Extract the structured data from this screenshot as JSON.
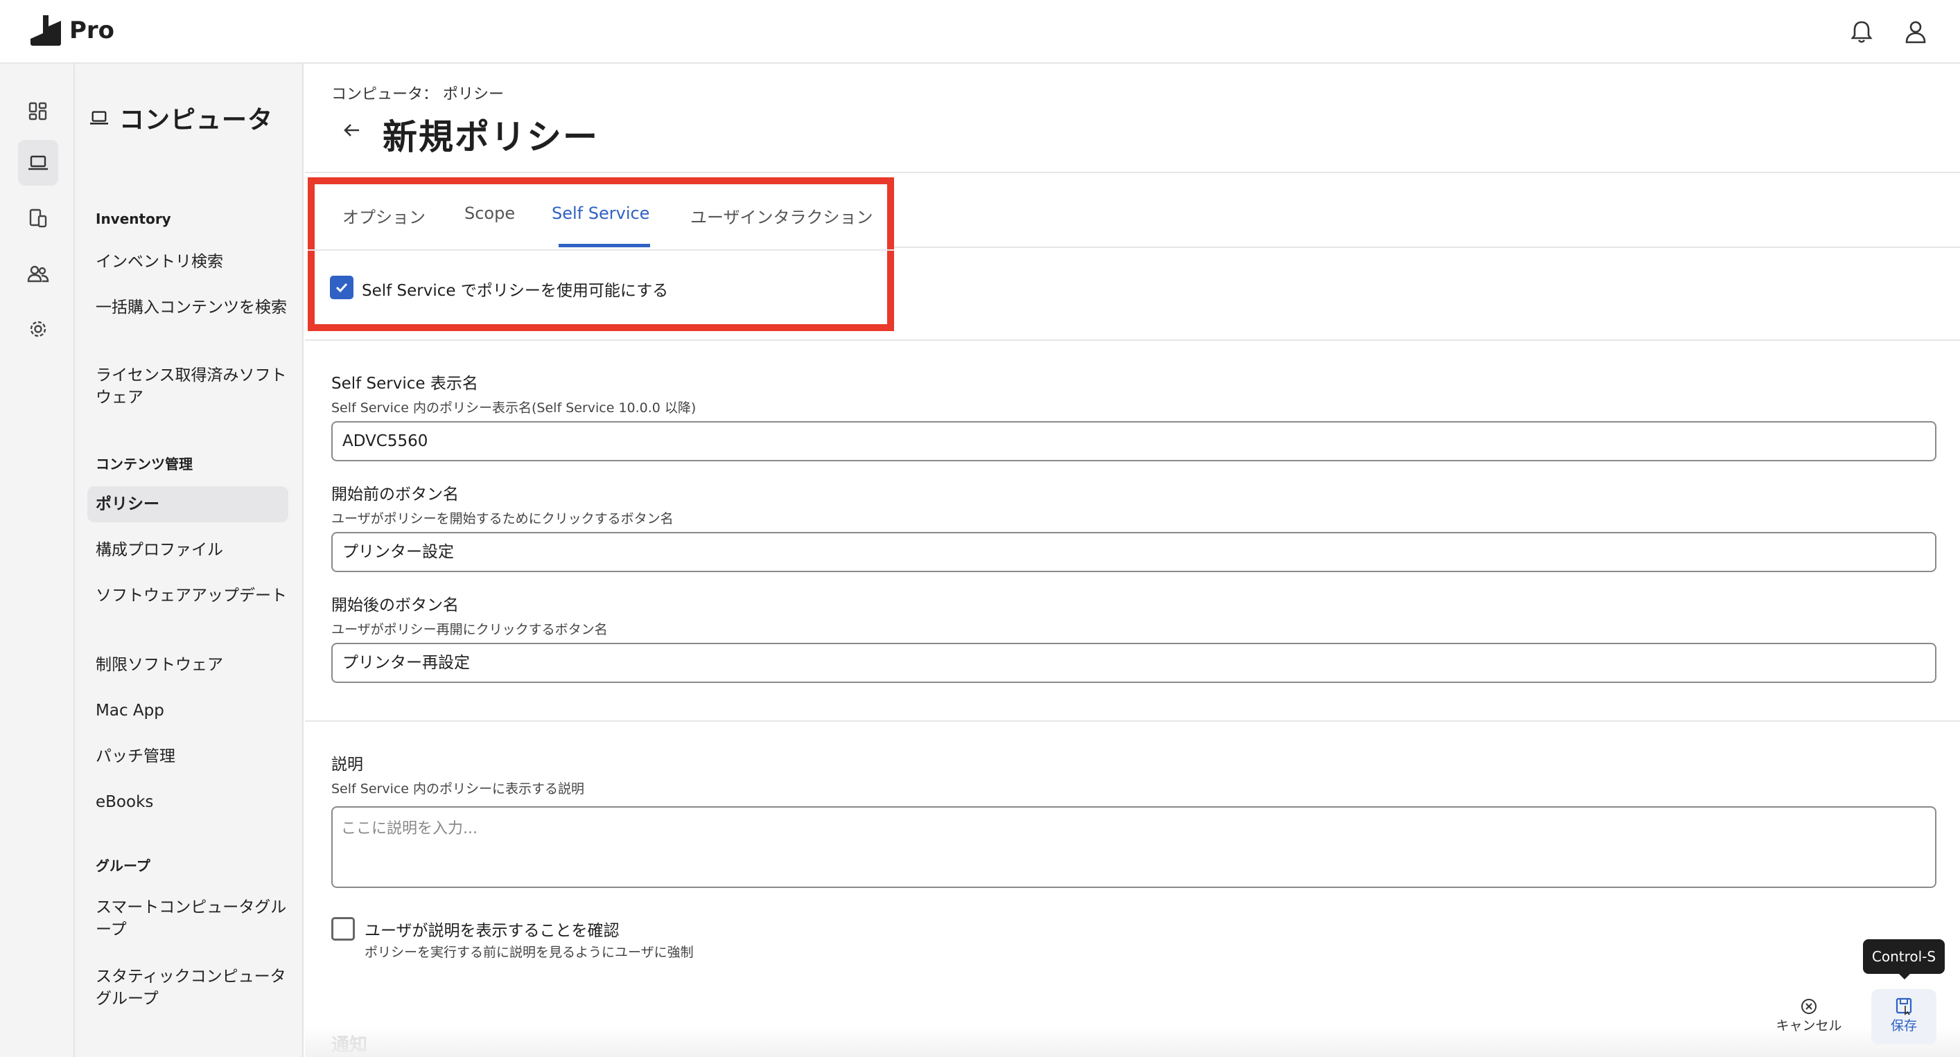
{
  "app": {
    "brand": "Pro"
  },
  "sidebar": {
    "header": "コンピュータ",
    "sections": [
      {
        "title": "Inventory",
        "items": [
          "インベントリ検索",
          "一括購入コンテンツを検索",
          "ライセンス取得済みソフトウェア"
        ]
      },
      {
        "title": "コンテンツ管理",
        "items": [
          "ポリシー",
          "構成プロファイル",
          "ソフトウェアアップデート",
          "制限ソフトウェア",
          "Mac App",
          "パッチ管理",
          "eBooks"
        ]
      },
      {
        "title": "グループ",
        "items": [
          "スマートコンピュータグループ",
          "スタティックコンピュータグループ"
        ]
      }
    ],
    "active_item": "ポリシー"
  },
  "header": {
    "breadcrumb": "コンピュータ：  ポリシー",
    "title": "新規ポリシー"
  },
  "tabs": [
    {
      "label": "オプション",
      "active": false
    },
    {
      "label": "Scope",
      "active": false
    },
    {
      "label": "Self Service",
      "active": true
    },
    {
      "label": "ユーザインタラクション",
      "active": false
    }
  ],
  "self_service": {
    "enable_label": "Self Service でポリシーを使用可能にする",
    "enable_checked": true,
    "display_name": {
      "label": "Self Service 表示名",
      "help": "Self Service 内のポリシー表示名(Self Service 10.0.0 以降)",
      "value": "ADVC5560"
    },
    "button_before": {
      "label": "開始前のボタン名",
      "help": "ユーザがポリシーを開始するためにクリックするボタン名",
      "value": "プリンター設定"
    },
    "button_after": {
      "label": "開始後のボタン名",
      "help": "ユーザがポリシー再開にクリックするボタン名",
      "value": "プリンター再設定"
    },
    "description": {
      "label": "説明",
      "help": "Self Service 内のポリシーに表示する説明",
      "placeholder": "ここに説明を入力..."
    },
    "confirm": {
      "label": "ユーザが説明を表示することを確認",
      "help": "ポリシーを実行する前に説明を見るようにユーザに強制",
      "checked": false
    },
    "next_section": "通知"
  },
  "actions": {
    "cancel": "キャンセル",
    "save": "保存",
    "save_tooltip": "Control-S"
  },
  "colors": {
    "accent": "#2f62c4",
    "highlight_border": "#e8392a"
  }
}
